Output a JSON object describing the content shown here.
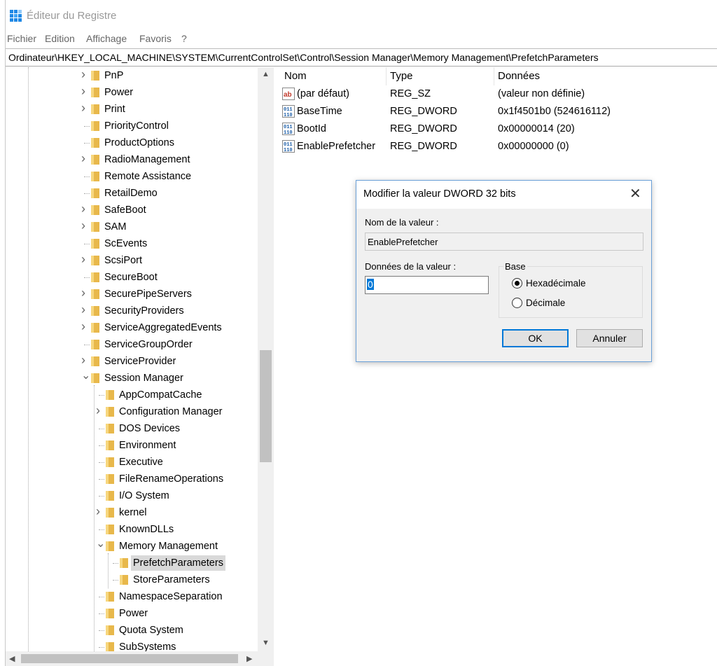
{
  "window": {
    "title": "Éditeur du Registre",
    "icon": "registry-editor-icon"
  },
  "menu": [
    "Fichier",
    "Edition",
    "Affichage",
    "Favoris",
    "?"
  ],
  "address": "Ordinateur\\HKEY_LOCAL_MACHINE\\SYSTEM\\CurrentControlSet\\Control\\Session Manager\\Memory Management\\PrefetchParameters",
  "tree": [
    {
      "label": "PnP",
      "level": 0,
      "expander": "collapsed"
    },
    {
      "label": "Power",
      "level": 0,
      "expander": "collapsed"
    },
    {
      "label": "Print",
      "level": 0,
      "expander": "collapsed"
    },
    {
      "label": "PriorityControl",
      "level": 0,
      "expander": "none"
    },
    {
      "label": "ProductOptions",
      "level": 0,
      "expander": "none"
    },
    {
      "label": "RadioManagement",
      "level": 0,
      "expander": "collapsed"
    },
    {
      "label": "Remote Assistance",
      "level": 0,
      "expander": "none"
    },
    {
      "label": "RetailDemo",
      "level": 0,
      "expander": "none"
    },
    {
      "label": "SafeBoot",
      "level": 0,
      "expander": "collapsed"
    },
    {
      "label": "SAM",
      "level": 0,
      "expander": "collapsed"
    },
    {
      "label": "ScEvents",
      "level": 0,
      "expander": "none"
    },
    {
      "label": "ScsiPort",
      "level": 0,
      "expander": "collapsed"
    },
    {
      "label": "SecureBoot",
      "level": 0,
      "expander": "none"
    },
    {
      "label": "SecurePipeServers",
      "level": 0,
      "expander": "collapsed"
    },
    {
      "label": "SecurityProviders",
      "level": 0,
      "expander": "collapsed"
    },
    {
      "label": "ServiceAggregatedEvents",
      "level": 0,
      "expander": "collapsed"
    },
    {
      "label": "ServiceGroupOrder",
      "level": 0,
      "expander": "none"
    },
    {
      "label": "ServiceProvider",
      "level": 0,
      "expander": "collapsed"
    },
    {
      "label": "Session Manager",
      "level": 0,
      "expander": "expanded"
    },
    {
      "label": "AppCompatCache",
      "level": 1,
      "expander": "none"
    },
    {
      "label": "Configuration Manager",
      "level": 1,
      "expander": "collapsed"
    },
    {
      "label": "DOS Devices",
      "level": 1,
      "expander": "none"
    },
    {
      "label": "Environment",
      "level": 1,
      "expander": "none"
    },
    {
      "label": "Executive",
      "level": 1,
      "expander": "none"
    },
    {
      "label": "FileRenameOperations",
      "level": 1,
      "expander": "none"
    },
    {
      "label": "I/O System",
      "level": 1,
      "expander": "none"
    },
    {
      "label": "kernel",
      "level": 1,
      "expander": "collapsed"
    },
    {
      "label": "KnownDLLs",
      "level": 1,
      "expander": "none"
    },
    {
      "label": "Memory Management",
      "level": 1,
      "expander": "expanded"
    },
    {
      "label": "PrefetchParameters",
      "level": 2,
      "expander": "none",
      "selected": true
    },
    {
      "label": "StoreParameters",
      "level": 2,
      "expander": "none"
    },
    {
      "label": "NamespaceSeparation",
      "level": 1,
      "expander": "none"
    },
    {
      "label": "Power",
      "level": 1,
      "expander": "none"
    },
    {
      "label": "Quota System",
      "level": 1,
      "expander": "none"
    },
    {
      "label": "SubSystems",
      "level": 1,
      "expander": "none"
    }
  ],
  "list": {
    "headers": [
      "Nom",
      "Type",
      "Données"
    ],
    "rows": [
      {
        "icon": "string-value-icon",
        "name": "(par défaut)",
        "type": "REG_SZ",
        "data": "(valeur non définie)"
      },
      {
        "icon": "binary-value-icon",
        "name": "BaseTime",
        "type": "REG_DWORD",
        "data": "0x1f4501b0 (524616112)"
      },
      {
        "icon": "binary-value-icon",
        "name": "BootId",
        "type": "REG_DWORD",
        "data": "0x00000014 (20)"
      },
      {
        "icon": "binary-value-icon",
        "name": "EnablePrefetcher",
        "type": "REG_DWORD",
        "data": "0x00000000 (0)"
      }
    ]
  },
  "dialog": {
    "title": "Modifier la valeur DWORD 32 bits",
    "name_label": "Nom de la valeur :",
    "name_value": "EnablePrefetcher",
    "data_label": "Données de la valeur :",
    "data_value": "0",
    "base_label": "Base",
    "base_options": [
      "Hexadécimale",
      "Décimale"
    ],
    "base_selected": "Hexadécimale",
    "ok": "OK",
    "cancel": "Annuler"
  },
  "colors": {
    "accent": "#0078d7",
    "folder": "#e8b84b",
    "selection": "#d9d9d9"
  }
}
